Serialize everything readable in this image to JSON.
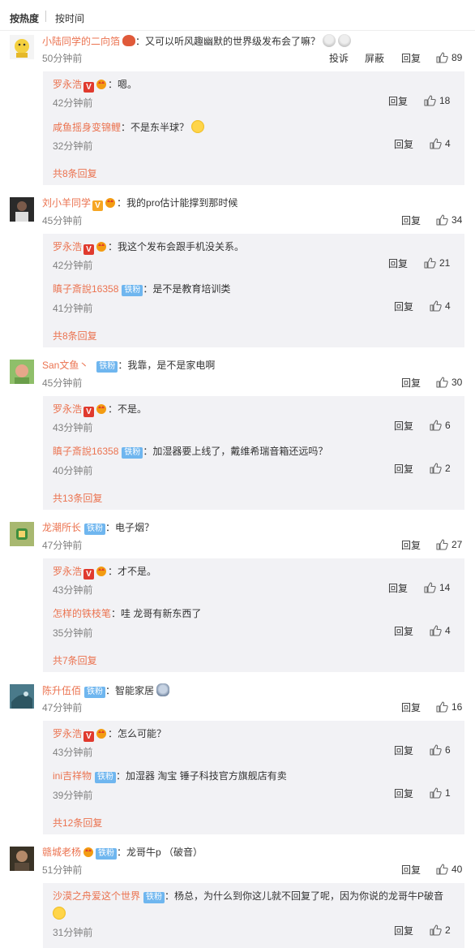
{
  "sort": {
    "hot": "按热度",
    "time": "按时间"
  },
  "actions": {
    "report": "投诉",
    "block": "屏蔽",
    "reply": "回复"
  },
  "badges": {
    "fan": "铁粉",
    "v": "V"
  },
  "colon": "：",
  "comments": [
    {
      "user": "小陆同学的二向箔",
      "text": "又可以听风趣幽默的世界级发布会了嘛？",
      "time": "50分钟前",
      "likes": "89",
      "replies": [
        {
          "user": "罗永浩",
          "text": "嗯。",
          "time": "42分钟前",
          "likes": "18"
        },
        {
          "user": "咸鱼摇身变锦鲤",
          "text": "不是东半球？",
          "time": "32分钟前",
          "likes": "4"
        }
      ],
      "more": "共8条回复"
    },
    {
      "user": "刘小羊同学",
      "text": "我的pro估计能撑到那时候",
      "time": "45分钟前",
      "likes": "34",
      "replies": [
        {
          "user": "罗永浩",
          "text": "我这个发布会跟手机没关系。",
          "time": "42分钟前",
          "likes": "21"
        },
        {
          "user": "瞋子斎說16358",
          "text": "是不是教育培训类",
          "time": "41分钟前",
          "likes": "4"
        }
      ],
      "more": "共8条回复"
    },
    {
      "user": "San文鱼丶",
      "text": "我靠，是不是家电啊",
      "time": "45分钟前",
      "likes": "30",
      "replies": [
        {
          "user": "罗永浩",
          "text": "不是。",
          "time": "43分钟前",
          "likes": "6"
        },
        {
          "user": "瞋子斎說16358",
          "text": "加湿器要上线了，戴维希瑞音箱还远吗？",
          "time": "40分钟前",
          "likes": "2"
        }
      ],
      "more": "共13条回复"
    },
    {
      "user": "龙潮所长",
      "text": "电子烟？",
      "time": "47分钟前",
      "likes": "27",
      "replies": [
        {
          "user": "罗永浩",
          "text": "才不是。",
          "time": "43分钟前",
          "likes": "14"
        },
        {
          "user": "怎样的铁枝笔",
          "text": "哇 龙哥有新东西了",
          "time": "35分钟前",
          "likes": "4"
        }
      ],
      "more": "共7条回复"
    },
    {
      "user": "陈升伍佰",
      "text": "智能家居",
      "time": "47分钟前",
      "likes": "16",
      "replies": [
        {
          "user": "罗永浩",
          "text": "怎么可能？",
          "time": "43分钟前",
          "likes": "6"
        },
        {
          "user": "ini吉祥物",
          "text": "加湿器 淘宝 锤子科技官方旗舰店有卖",
          "time": "39分钟前",
          "likes": "1"
        }
      ],
      "more": "共12条回复"
    },
    {
      "user": "赣城老杨",
      "text": "龙哥牛p （破音）",
      "time": "51分钟前",
      "likes": "40",
      "replies": [
        {
          "user": "沙漠之舟爱这个世界",
          "text": "杨总，为什么到你这儿就不回复了呢，因为你说的龙哥牛P破音",
          "time": "31分钟前",
          "likes": "2"
        }
      ],
      "more": ""
    }
  ]
}
